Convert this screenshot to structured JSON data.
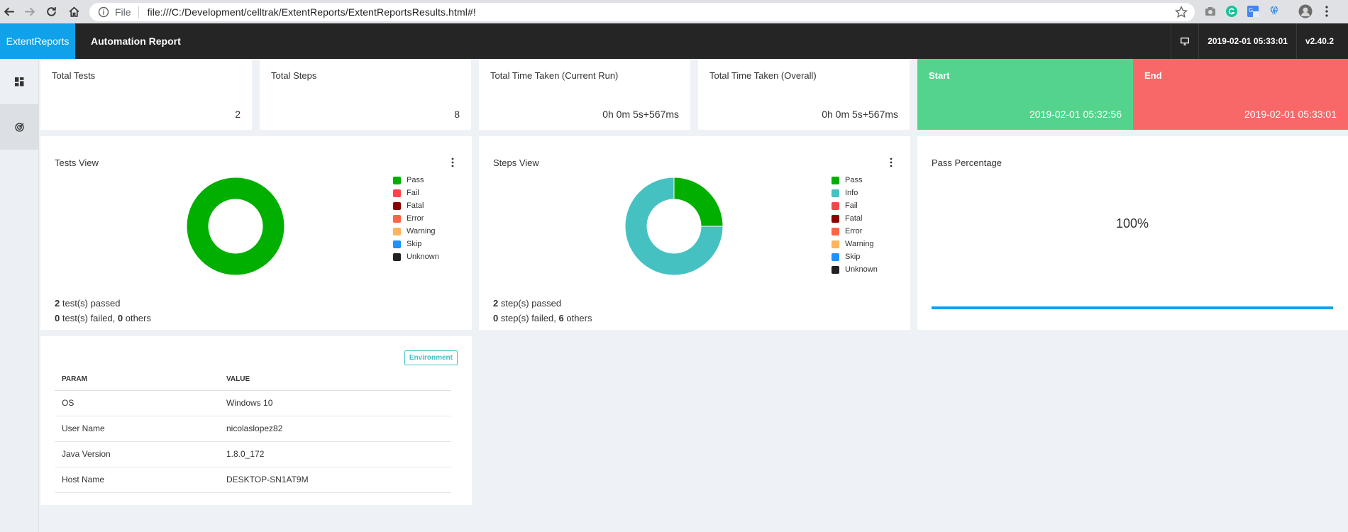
{
  "browser": {
    "file_label": "File",
    "url": "file:///C:/Development/celltrak/ExtentReports/ExtentReportsResults.html#!"
  },
  "header": {
    "brand": "ExtentReports",
    "title": "Automation Report",
    "timestamp": "2019-02-01 05:33:01",
    "version": "v2.40.2"
  },
  "stats": {
    "total_tests_label": "Total Tests",
    "total_tests_value": "2",
    "total_steps_label": "Total Steps",
    "total_steps_value": "8",
    "time_current_label": "Total Time Taken (Current Run)",
    "time_current_value": "0h 0m 5s+567ms",
    "time_overall_label": "Total Time Taken (Overall)",
    "time_overall_value": "0h 0m 5s+567ms",
    "start_label": "Start",
    "start_value": "2019-02-01 05:32:56",
    "end_label": "End",
    "end_value": "2019-02-01 05:33:01"
  },
  "colors": {
    "accent": "#0fa1e9",
    "pass": "#00af00",
    "info": "#46c1c2",
    "fail": "#f7464a",
    "fatal": "#8b0000",
    "error": "#ff6347",
    "warning": "#fdb45c",
    "skip": "#1e90ff",
    "unknown": "#222222",
    "start_bg": "#54d38c",
    "end_bg": "#f96868"
  },
  "tests_view": {
    "title": "Tests View",
    "legend": [
      {
        "label": "Pass",
        "color": "#00af00"
      },
      {
        "label": "Fail",
        "color": "#f7464a"
      },
      {
        "label": "Fatal",
        "color": "#8b0000"
      },
      {
        "label": "Error",
        "color": "#ff6347"
      },
      {
        "label": "Warning",
        "color": "#fdb45c"
      },
      {
        "label": "Skip",
        "color": "#1e90ff"
      },
      {
        "label": "Unknown",
        "color": "#222222"
      }
    ],
    "line1": {
      "count": "2",
      "text": " test(s) passed"
    },
    "line2": {
      "failed": "0",
      "failed_text": " test(s) failed, ",
      "others": "0",
      "others_text": " others"
    }
  },
  "steps_view": {
    "title": "Steps View",
    "legend": [
      {
        "label": "Pass",
        "color": "#00af00"
      },
      {
        "label": "Info",
        "color": "#46c1c2"
      },
      {
        "label": "Fail",
        "color": "#f7464a"
      },
      {
        "label": "Fatal",
        "color": "#8b0000"
      },
      {
        "label": "Error",
        "color": "#ff6347"
      },
      {
        "label": "Warning",
        "color": "#fdb45c"
      },
      {
        "label": "Skip",
        "color": "#1e90ff"
      },
      {
        "label": "Unknown",
        "color": "#222222"
      }
    ],
    "line1": {
      "count": "2",
      "text": " step(s) passed"
    },
    "line2": {
      "failed": "0",
      "failed_text": " step(s) failed, ",
      "others": "6",
      "others_text": " others"
    }
  },
  "pass_percentage": {
    "title": "Pass Percentage",
    "value": "100%",
    "fraction": 1.0
  },
  "chart_data": [
    {
      "type": "pie",
      "categories": [
        "Pass",
        "Fail",
        "Fatal",
        "Error",
        "Warning",
        "Skip",
        "Unknown"
      ],
      "values": [
        2,
        0,
        0,
        0,
        0,
        0,
        0
      ],
      "title": "Tests View"
    },
    {
      "type": "pie",
      "categories": [
        "Pass",
        "Info",
        "Fail",
        "Fatal",
        "Error",
        "Warning",
        "Skip",
        "Unknown"
      ],
      "values": [
        2,
        6,
        0,
        0,
        0,
        0,
        0,
        0
      ],
      "title": "Steps View"
    }
  ],
  "environment": {
    "badge": "Environment",
    "headers": [
      "PARAM",
      "VALUE"
    ],
    "rows": [
      [
        "OS",
        "Windows 10"
      ],
      [
        "User Name",
        "nicolaslopez82"
      ],
      [
        "Java Version",
        "1.8.0_172"
      ],
      [
        "Host Name",
        "DESKTOP-SN1AT9M"
      ]
    ]
  }
}
